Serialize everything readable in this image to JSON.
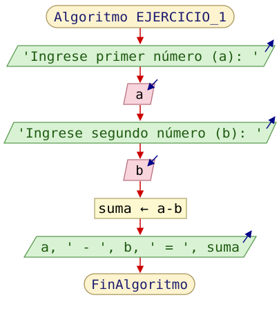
{
  "diagram": {
    "type": "flowchart",
    "colors": {
      "connector": "#cc0000",
      "io_arrow": "#000088",
      "terminal_fill": "#fdf3cf",
      "terminal_stroke": "#a8955a",
      "terminal_text": "#1a1a6e",
      "output_fill": "#d9f2d4",
      "output_stroke": "#5a9a50",
      "output_text": "#1e5a10",
      "input_fill": "#f8d4dc",
      "input_stroke": "#b8707e",
      "input_text": "#000000",
      "process_fill": "#fdf8cf",
      "process_stroke": "#b0a870",
      "process_text": "#000000"
    },
    "nodes": {
      "start": {
        "kind": "terminal",
        "text": "Algoritmo EJERCICIO_1"
      },
      "write_a": {
        "kind": "output",
        "text": "'Ingrese primer número (a): '"
      },
      "read_a": {
        "kind": "input",
        "text": "a"
      },
      "write_b": {
        "kind": "output",
        "text": "'Ingrese segundo número (b): '"
      },
      "read_b": {
        "kind": "input",
        "text": "b"
      },
      "assign": {
        "kind": "process",
        "text": "suma ← a-b"
      },
      "write_result": {
        "kind": "output",
        "text": "a, ' - ', b, ' = ', suma"
      },
      "end": {
        "kind": "terminal",
        "text": "FinAlgoritmo"
      }
    }
  }
}
